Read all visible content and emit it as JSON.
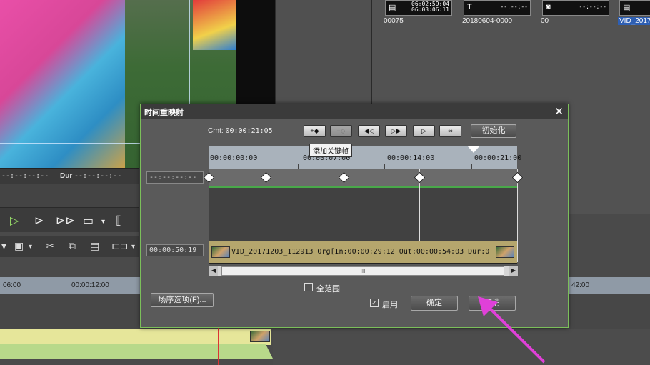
{
  "bin": {
    "clips": [
      {
        "label": "00075",
        "line1": "06:02:59:04",
        "line2": "06:03:06:11",
        "icon": "film-icon",
        "selected": false
      },
      {
        "label": "20180604-0000",
        "line1": "--:--:--",
        "line2": "",
        "icon": "title-icon",
        "selected": false
      },
      {
        "label": "00",
        "line1": "--:--:--",
        "line2": "",
        "icon": "camera-icon",
        "selected": false
      },
      {
        "label": "VID_2017",
        "line1": "",
        "line2": "",
        "icon": "film-icon",
        "selected": true
      }
    ]
  },
  "player": {
    "in_tc": "--:--:--:--",
    "dur_label": "Dur",
    "dur_tc": "--:--:--:--"
  },
  "timeline": {
    "ruler_ticks": [
      "06:00",
      "00:00:12:00",
      "42:00"
    ]
  },
  "dialog": {
    "title": "时间重映射",
    "crnt_label": "Crnt:",
    "crnt_value": "00:00:21:05",
    "tooltip": "添加关键帧",
    "init_button": "初始化",
    "ruler_labels": [
      "00:00:00:00",
      "00:00:07:00",
      "00:00:14:00",
      "00:00:21:00"
    ],
    "lane_tc": "--:--:--:--",
    "clip_tc": "00:00:50:19",
    "clip_text": "VID_20171203_112913  Org[In:00:00:29:12 Out:00:00:54:03  Dur:0",
    "full_range_label": "全范围",
    "full_range_checked": false,
    "enable_label": "启用",
    "enable_checked": true,
    "sequence_options_button": "场序选项(F)...",
    "ok_button": "确定",
    "cancel_button": "取消",
    "keyframes": [
      0,
      0.186,
      0.437,
      0.683,
      1.0
    ],
    "cursor_position": 0.858,
    "arrow_color": "#e040d8",
    "accent_color": "#7bbf5a"
  }
}
